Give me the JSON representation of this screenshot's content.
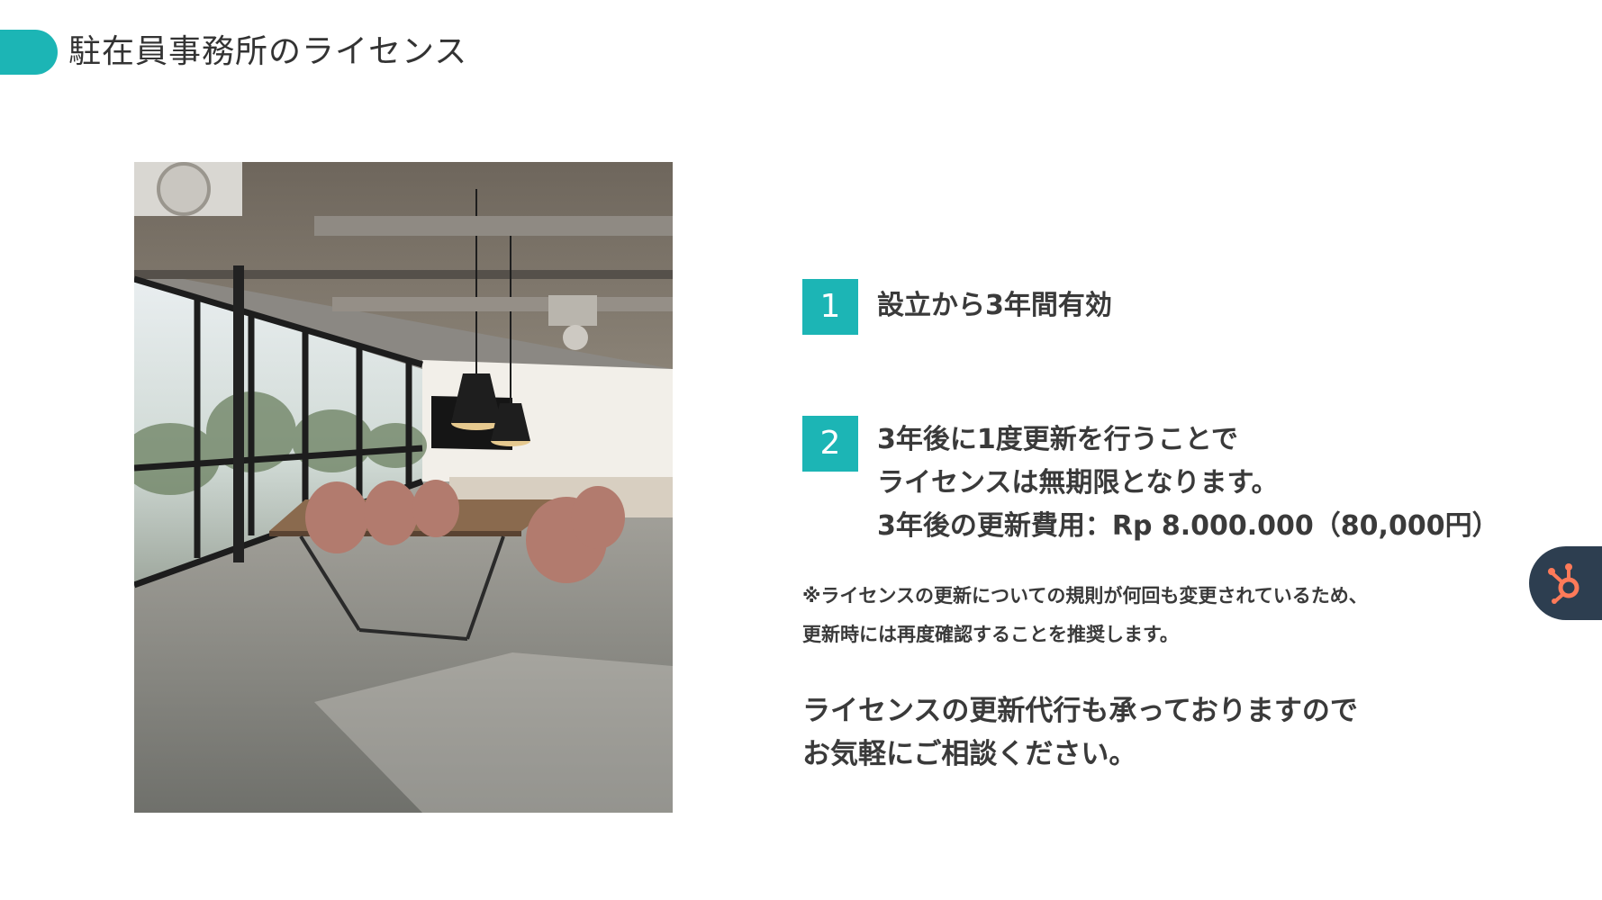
{
  "header": {
    "title": "駐在員事務所のライセンス",
    "accent_color": "#1cb5b5"
  },
  "photo": {
    "icon": "conference-room-photo"
  },
  "items": [
    {
      "number": "1",
      "lines": [
        "設立から3年間有効"
      ]
    },
    {
      "number": "2",
      "lines": [
        "3年後に1度更新を行うことで",
        "ライセンスは無期限となります。",
        "3年後の更新費用：Rp 8.000.000（80,000円）"
      ]
    }
  ],
  "note": {
    "lines": [
      "※ライセンスの更新についての規則が何回も変更されているため、",
      "更新時には再度確認することを推奨します。"
    ]
  },
  "cta": {
    "lines": [
      "ライセンスの更新代行も承っておりますので",
      "お気軽にご相談ください。"
    ]
  },
  "badge": {
    "icon": "hubspot-sprocket-icon",
    "bg_color": "#2d3e50",
    "icon_color": "#ff7a59"
  }
}
